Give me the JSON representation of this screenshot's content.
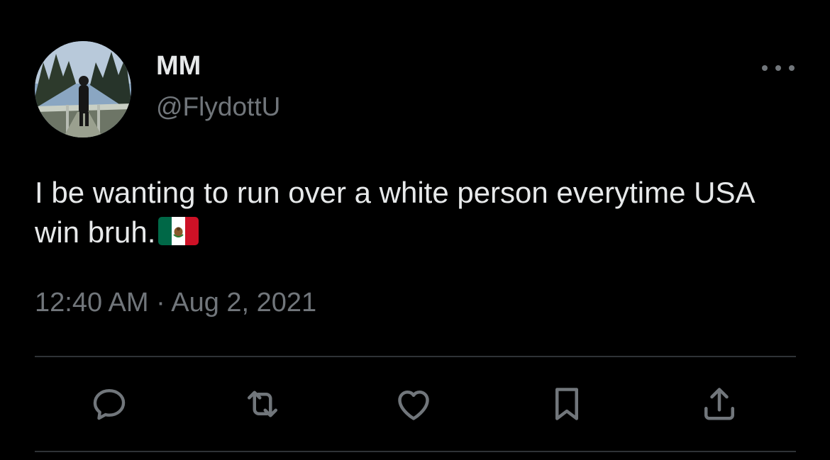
{
  "tweet": {
    "author": {
      "display_name": "MM",
      "handle": "@FlydottU"
    },
    "text": "I be wanting to run over a white person everytime USA win bruh.",
    "emoji": "mexico-flag",
    "timestamp": "12:40 AM · Aug 2, 2021"
  },
  "actions": [
    "reply",
    "retweet",
    "like",
    "bookmark",
    "share"
  ],
  "colors": {
    "background": "#000000",
    "primary_text": "#e7e9ea",
    "secondary_text": "#71767b",
    "divider": "#2f3336"
  }
}
